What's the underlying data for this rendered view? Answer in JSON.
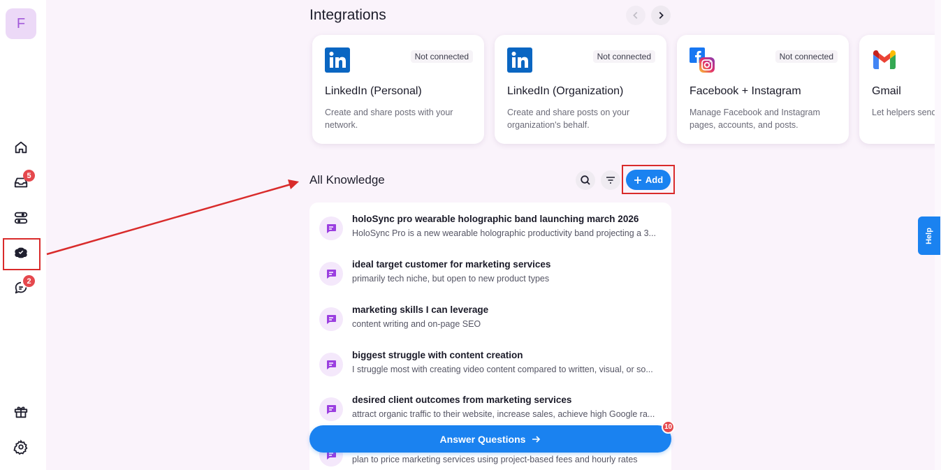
{
  "sidebar": {
    "avatar_letter": "F",
    "nav": [
      {
        "name": "home",
        "icon": "home-icon",
        "badge": ""
      },
      {
        "name": "inbox",
        "icon": "inbox-icon",
        "badge": "5"
      },
      {
        "name": "workflows",
        "icon": "workflows-icon",
        "badge": ""
      },
      {
        "name": "brain",
        "icon": "brain-icon",
        "badge": ""
      },
      {
        "name": "chat",
        "icon": "chat-icon",
        "badge": "2"
      },
      {
        "name": "gift",
        "icon": "gift-icon",
        "badge": ""
      },
      {
        "name": "settings",
        "icon": "gear-icon",
        "badge": ""
      }
    ]
  },
  "integrations": {
    "title": "Integrations",
    "cards": [
      {
        "name": "LinkedIn (Personal)",
        "status": "Not connected",
        "description": "Create and share posts with your network.",
        "logo": "linkedin-icon"
      },
      {
        "name": "LinkedIn (Organization)",
        "status": "Not connected",
        "description": "Create and share posts on your organization's behalf.",
        "logo": "linkedin-icon"
      },
      {
        "name": "Facebook + Instagram",
        "status": "Not connected",
        "description": "Manage Facebook and Instagram pages, accounts, and posts.",
        "logo": "facebook-instagram-icon"
      },
      {
        "name": "Gmail",
        "status": "",
        "description": "Let helpers send inbox.",
        "logo": "gmail-icon"
      }
    ]
  },
  "knowledge": {
    "title": "All Knowledge",
    "add_label": "Add",
    "items": [
      {
        "title": "holoSync pro wearable holographic band launching march 2026",
        "subtitle": "HoloSync Pro is a new wearable holographic productivity band projecting a 3..."
      },
      {
        "title": "ideal target customer for marketing services",
        "subtitle": "primarily tech niche, but open to new product types"
      },
      {
        "title": "marketing skills I can leverage",
        "subtitle": "content writing and on-page SEO"
      },
      {
        "title": "biggest struggle with content creation",
        "subtitle": "I struggle most with creating video content compared to written, visual, or so..."
      },
      {
        "title": "desired client outcomes from marketing services",
        "subtitle": "attract organic traffic to their website, increase sales, achieve high Google ra..."
      },
      {
        "title": "",
        "subtitle": "plan to price marketing services using project-based fees and hourly rates"
      }
    ]
  },
  "answer_button": {
    "label": "Answer Questions",
    "badge": "10"
  },
  "help": {
    "label": "Help"
  },
  "colors": {
    "accent": "#1a82f0",
    "badge": "#e5484d",
    "highlight": "#d92b2b"
  }
}
